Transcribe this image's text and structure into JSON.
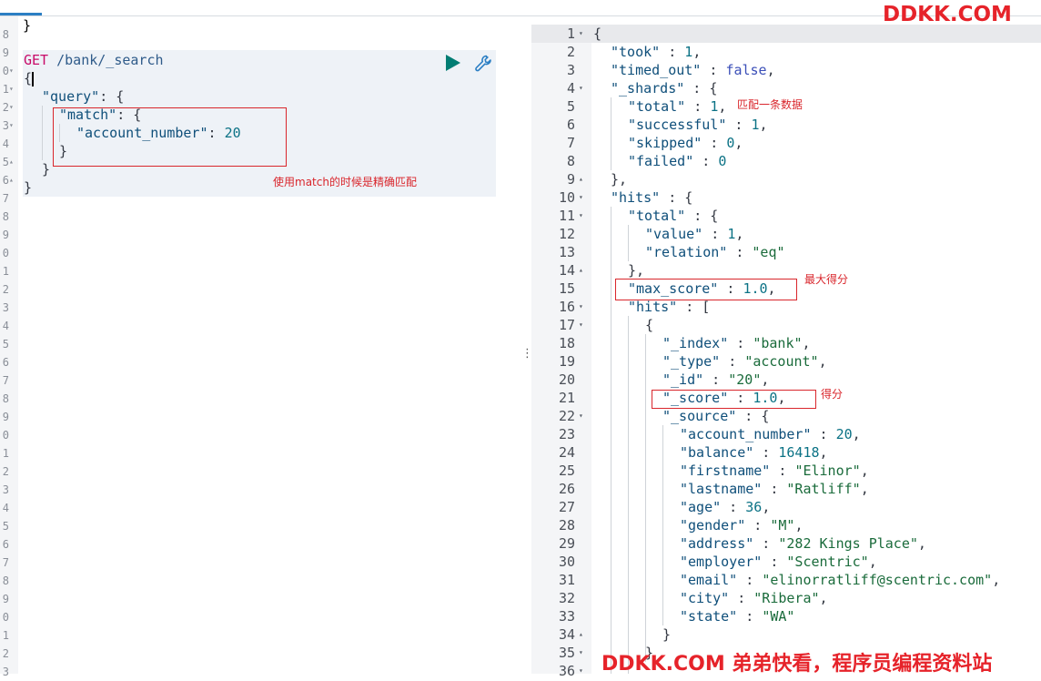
{
  "colors": {
    "accent": "#2c7fc4",
    "play": "#017d73",
    "annotation": "#d9262c",
    "watermark": "#e6232a"
  },
  "icons": {
    "run": "play-icon",
    "settings": "wrench-icon"
  },
  "left": {
    "gutter_numbers": [
      "8",
      "9",
      "0",
      "1",
      "2",
      "3",
      "4",
      "5",
      "6",
      "7",
      "8",
      "9",
      "0",
      "1",
      "2",
      "3",
      "4",
      "5",
      "6",
      "7",
      "8",
      "9",
      "0",
      "1",
      "2",
      "3",
      "4",
      "5",
      "6",
      "7",
      "8",
      "9",
      "0",
      "1",
      "2",
      "3"
    ],
    "top_fragment": "}",
    "request": {
      "method": "GET",
      "path": " /bank/_search",
      "lines": {
        "l1": "{",
        "l2_key": "\"query\"",
        "l2_rest": ": {",
        "l3_key": "\"match\"",
        "l3_rest": ": {",
        "l4_key": "\"account_number\"",
        "l4_sep": ": ",
        "l4_val": "20",
        "l5": "}",
        "l6": "}",
        "l7": "}"
      }
    },
    "annotation": "使用match的时候是精确匹配"
  },
  "right": {
    "line_numbers": [
      "1",
      "2",
      "3",
      "4",
      "5",
      "6",
      "7",
      "8",
      "9",
      "10",
      "11",
      "12",
      "13",
      "14",
      "15",
      "16",
      "17",
      "18",
      "19",
      "20",
      "21",
      "22",
      "23",
      "24",
      "25",
      "26",
      "27",
      "28",
      "29",
      "30",
      "31",
      "32",
      "33",
      "34",
      "35",
      "36"
    ],
    "annotations": {
      "shards_total": "匹配一条数据",
      "max_score": "最大得分",
      "score": "得分"
    },
    "response": {
      "took_key": "\"took\"",
      "took_val": "1",
      "timed_out_key": "\"timed_out\"",
      "timed_out_val": "false",
      "shards_key": "\"_shards\"",
      "total_key": "\"total\"",
      "total_val": "1",
      "successful_key": "\"successful\"",
      "successful_val": "1",
      "skipped_key": "\"skipped\"",
      "skipped_val": "0",
      "failed_key": "\"failed\"",
      "failed_val": "0",
      "hits_key": "\"hits\"",
      "hits_total_key": "\"total\"",
      "value_key": "\"value\"",
      "value_val": "1",
      "relation_key": "\"relation\"",
      "relation_val": "\"eq\"",
      "max_score_key": "\"max_score\"",
      "max_score_val": "1.0",
      "hits_arr_key": "\"hits\"",
      "index_key": "\"_index\"",
      "index_val": "\"bank\"",
      "type_key": "\"_type\"",
      "type_val": "\"account\"",
      "id_key": "\"_id\"",
      "id_val": "\"20\"",
      "score_key": "\"_score\"",
      "score_val": "1.0",
      "source_key": "\"_source\"",
      "account_number_key": "\"account_number\"",
      "account_number_val": "20",
      "balance_key": "\"balance\"",
      "balance_val": "16418",
      "firstname_key": "\"firstname\"",
      "firstname_val": "\"Elinor\"",
      "lastname_key": "\"lastname\"",
      "lastname_val": "\"Ratliff\"",
      "age_key": "\"age\"",
      "age_val": "36",
      "gender_key": "\"gender\"",
      "gender_val": "\"M\"",
      "address_key": "\"address\"",
      "address_val": "\"282 Kings Place\"",
      "employer_key": "\"employer\"",
      "employer_val": "\"Scentric\"",
      "email_key": "\"email\"",
      "email_val": "\"elinorratliff@scentric.com\"",
      "city_key": "\"city\"",
      "city_val": "\"Ribera\"",
      "state_key": "\"state\"",
      "state_val": "\"WA\""
    }
  },
  "watermark_top": "DDKK.COM",
  "watermark_bottom": "DDKK.COM 弟弟快看，程序员编程资料站"
}
